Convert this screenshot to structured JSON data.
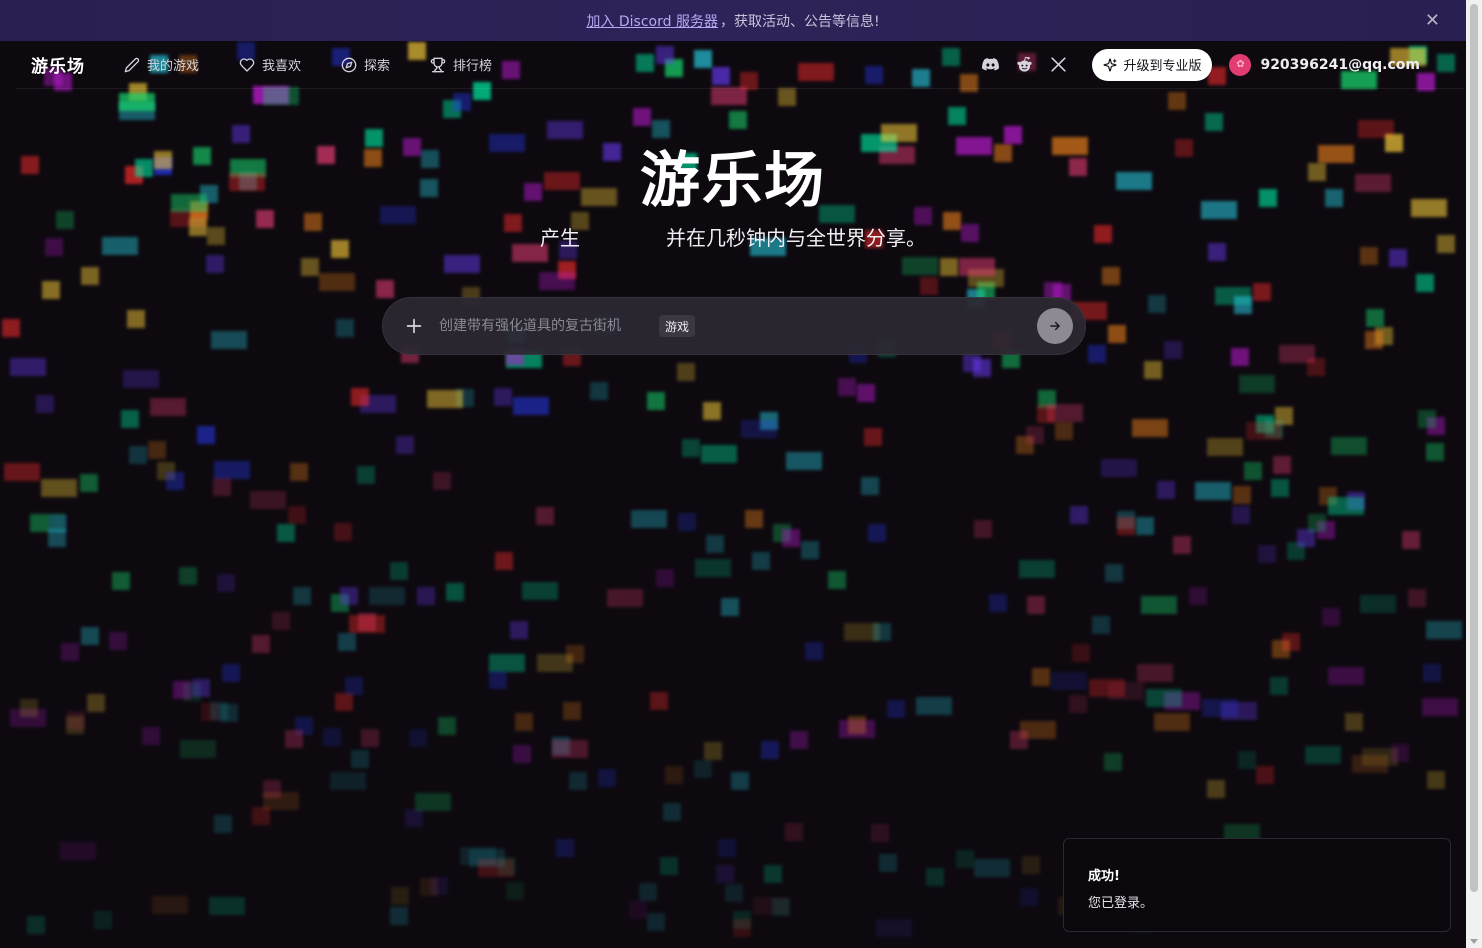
{
  "banner": {
    "link_text": "加入 Discord 服务器",
    "text": "，获取活动、公告等信息!",
    "close_icon": "close-icon"
  },
  "navbar": {
    "brand": "游乐场",
    "items": [
      {
        "label": "我的游戏",
        "icon": "pencil-icon"
      },
      {
        "label": "我喜欢",
        "icon": "heart-icon"
      },
      {
        "label": "探索",
        "icon": "compass-icon"
      },
      {
        "label": "排行榜",
        "icon": "trophy-icon"
      }
    ],
    "social": [
      {
        "icon": "discord-icon"
      },
      {
        "icon": "reddit-icon"
      },
      {
        "icon": "x-icon"
      }
    ],
    "upgrade_label": "升级到专业版",
    "user_email": "920396241@qq.com",
    "avatar_color": "#e33c73"
  },
  "hero": {
    "title": "游乐场",
    "subtitle_left": "产生",
    "subtitle_right": "并在几秒钟内与全世界分享。"
  },
  "prompt": {
    "placeholder": "创建带有强化道具的复古街机",
    "tag": "游戏"
  },
  "toast": {
    "title": "成功!",
    "body": "您已登录。"
  },
  "colors": {
    "background": "#0d090f",
    "banner": "#2e2258",
    "banner_link": "#b6a8f2",
    "pixel_palette": [
      "#00e5a0",
      "#27c4d9",
      "#e33c73",
      "#ff2d2d",
      "#ffd23a",
      "#6d3cff",
      "#2a3cff",
      "#ff8a1c",
      "#17d26b",
      "#c21bd9"
    ]
  }
}
